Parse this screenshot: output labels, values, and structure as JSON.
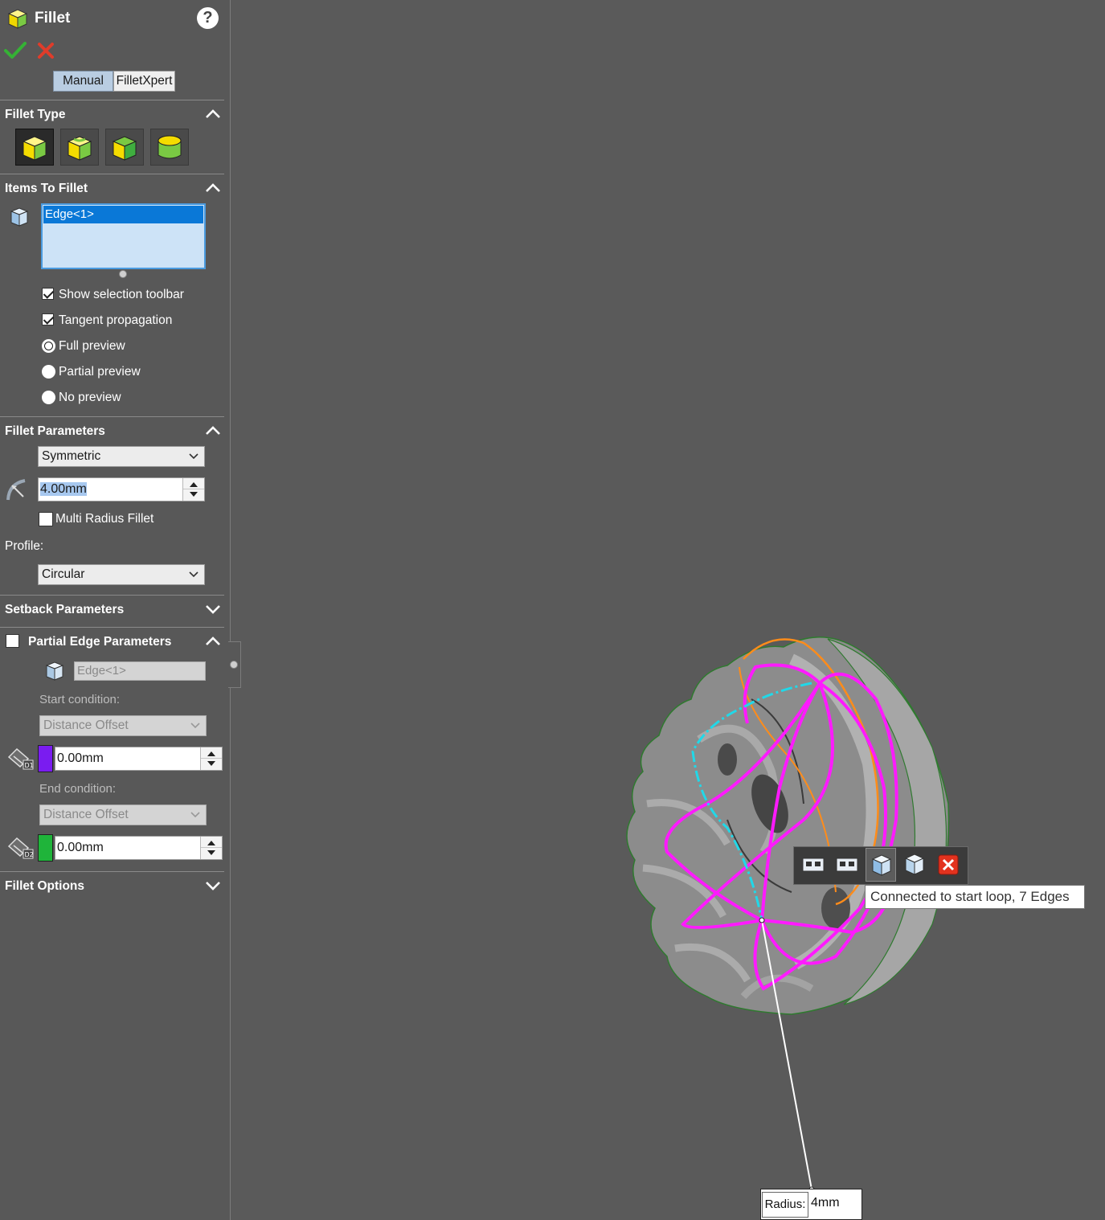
{
  "feature": {
    "title": "Fillet",
    "help": "?"
  },
  "actions": {
    "ok": "ok-check",
    "cancel": "cancel-x"
  },
  "mode_tabs": {
    "manual": "Manual",
    "expert": "FilletXpert"
  },
  "fillet_type": {
    "header": "Fillet Type",
    "types": [
      "constant-size-fillet-icon",
      "variable-size-fillet-icon",
      "face-fillet-icon",
      "full-round-fillet-icon"
    ]
  },
  "items": {
    "header": "Items To Fillet",
    "selection": "Edge<1>",
    "options": {
      "show_toolbar": "Show selection toolbar",
      "tangent": "Tangent propagation",
      "full": "Full preview",
      "partial": "Partial preview",
      "none": "No preview"
    }
  },
  "params": {
    "header": "Fillet Parameters",
    "method": "Symmetric",
    "radius": "4.00mm",
    "multi": "Multi Radius Fillet",
    "profile_label": "Profile:",
    "profile": "Circular"
  },
  "setback": {
    "header": "Setback Parameters"
  },
  "partial_edge": {
    "header": "Partial Edge Parameters",
    "edge": "Edge<1>",
    "start_label": "Start condition:",
    "start_value": "Distance Offset",
    "d1": "0.00mm",
    "end_label": "End condition:",
    "end_value": "Distance Offset",
    "d2": "0.00mm",
    "d1_color": "#7a1cf0",
    "d2_color": "#1fb43a"
  },
  "options": {
    "header": "Fillet Options"
  },
  "viewport": {
    "tooltip": "Connected to start loop, 7 Edges",
    "radius_label": "Radius:",
    "radius_value": "4mm",
    "toolbar_icons": [
      "connected-to-start-loop-icon",
      "connected-to-end-loop-icon",
      "connected-to-start-face-icon",
      "connected-to-end-face-icon",
      "delete-icon"
    ],
    "colors": {
      "highlight": "#ff1aff",
      "secondary": "#ff8c1a",
      "tangent": "#21d8e8",
      "background": "#5a5a5a",
      "panel": "#585858"
    }
  }
}
